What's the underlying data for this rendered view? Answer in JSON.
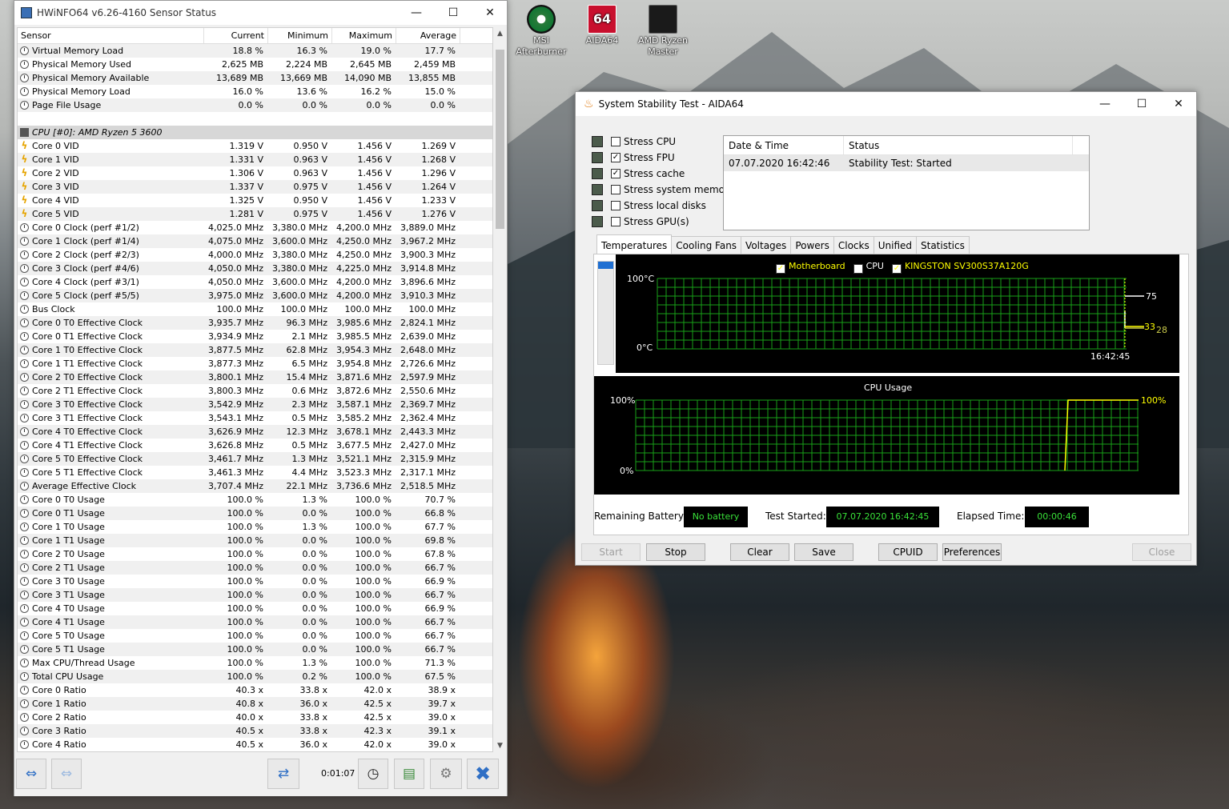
{
  "desktop": {
    "icons": [
      {
        "label": "MSI Afterburner"
      },
      {
        "label": "AIDA64"
      },
      {
        "label": "AMD Ryzen Master"
      }
    ]
  },
  "hwinfo": {
    "title": "HWiNFO64 v6.26-4160 Sensor Status",
    "columns": [
      "Sensor",
      "Current",
      "Minimum",
      "Maximum",
      "Average"
    ],
    "rows": [
      {
        "icon": "clock",
        "name": "Virtual Memory Load",
        "cur": "18.8 %",
        "min": "16.3 %",
        "max": "19.0 %",
        "avg": "17.7 %"
      },
      {
        "icon": "clock",
        "name": "Physical Memory Used",
        "cur": "2,625 MB",
        "min": "2,224 MB",
        "max": "2,645 MB",
        "avg": "2,459 MB"
      },
      {
        "icon": "clock",
        "name": "Physical Memory Available",
        "cur": "13,689 MB",
        "min": "13,669 MB",
        "max": "14,090 MB",
        "avg": "13,855 MB"
      },
      {
        "icon": "clock",
        "name": "Physical Memory Load",
        "cur": "16.0 %",
        "min": "13.6 %",
        "max": "16.2 %",
        "avg": "15.0 %"
      },
      {
        "icon": "clock",
        "name": "Page File Usage",
        "cur": "0.0 %",
        "min": "0.0 %",
        "max": "0.0 %",
        "avg": "0.0 %"
      },
      {
        "icon": "none",
        "name": "",
        "cur": "",
        "min": "",
        "max": "",
        "avg": ""
      },
      {
        "icon": "chip",
        "group": true,
        "name": "CPU [#0]: AMD Ryzen 5 3600",
        "cur": "",
        "min": "",
        "max": "",
        "avg": ""
      },
      {
        "icon": "volt",
        "name": "Core 0 VID",
        "cur": "1.319 V",
        "min": "0.950 V",
        "max": "1.456 V",
        "avg": "1.269 V"
      },
      {
        "icon": "volt",
        "name": "Core 1 VID",
        "cur": "1.331 V",
        "min": "0.963 V",
        "max": "1.456 V",
        "avg": "1.268 V"
      },
      {
        "icon": "volt",
        "name": "Core 2 VID",
        "cur": "1.306 V",
        "min": "0.963 V",
        "max": "1.456 V",
        "avg": "1.296 V"
      },
      {
        "icon": "volt",
        "name": "Core 3 VID",
        "cur": "1.337 V",
        "min": "0.975 V",
        "max": "1.456 V",
        "avg": "1.264 V"
      },
      {
        "icon": "volt",
        "name": "Core 4 VID",
        "cur": "1.325 V",
        "min": "0.950 V",
        "max": "1.456 V",
        "avg": "1.233 V"
      },
      {
        "icon": "volt",
        "name": "Core 5 VID",
        "cur": "1.281 V",
        "min": "0.975 V",
        "max": "1.456 V",
        "avg": "1.276 V"
      },
      {
        "icon": "clock",
        "name": "Core 0 Clock (perf #1/2)",
        "cur": "4,025.0 MHz",
        "min": "3,380.0 MHz",
        "max": "4,200.0 MHz",
        "avg": "3,889.0 MHz"
      },
      {
        "icon": "clock",
        "name": "Core 1 Clock (perf #1/4)",
        "cur": "4,075.0 MHz",
        "min": "3,600.0 MHz",
        "max": "4,250.0 MHz",
        "avg": "3,967.2 MHz"
      },
      {
        "icon": "clock",
        "name": "Core 2 Clock (perf #2/3)",
        "cur": "4,000.0 MHz",
        "min": "3,380.0 MHz",
        "max": "4,250.0 MHz",
        "avg": "3,900.3 MHz"
      },
      {
        "icon": "clock",
        "name": "Core 3 Clock (perf #4/6)",
        "cur": "4,050.0 MHz",
        "min": "3,380.0 MHz",
        "max": "4,225.0 MHz",
        "avg": "3,914.8 MHz"
      },
      {
        "icon": "clock",
        "name": "Core 4 Clock (perf #3/1)",
        "cur": "4,050.0 MHz",
        "min": "3,600.0 MHz",
        "max": "4,200.0 MHz",
        "avg": "3,896.6 MHz"
      },
      {
        "icon": "clock",
        "name": "Core 5 Clock (perf #5/5)",
        "cur": "3,975.0 MHz",
        "min": "3,600.0 MHz",
        "max": "4,200.0 MHz",
        "avg": "3,910.3 MHz"
      },
      {
        "icon": "clock",
        "name": "Bus Clock",
        "cur": "100.0 MHz",
        "min": "100.0 MHz",
        "max": "100.0 MHz",
        "avg": "100.0 MHz"
      },
      {
        "icon": "clock",
        "name": "Core 0 T0 Effective Clock",
        "cur": "3,935.7 MHz",
        "min": "96.3 MHz",
        "max": "3,985.6 MHz",
        "avg": "2,824.1 MHz"
      },
      {
        "icon": "clock",
        "name": "Core 0 T1 Effective Clock",
        "cur": "3,934.9 MHz",
        "min": "2.1 MHz",
        "max": "3,985.5 MHz",
        "avg": "2,639.0 MHz"
      },
      {
        "icon": "clock",
        "name": "Core 1 T0 Effective Clock",
        "cur": "3,877.5 MHz",
        "min": "62.8 MHz",
        "max": "3,954.3 MHz",
        "avg": "2,648.0 MHz"
      },
      {
        "icon": "clock",
        "name": "Core 1 T1 Effective Clock",
        "cur": "3,877.3 MHz",
        "min": "6.5 MHz",
        "max": "3,954.8 MHz",
        "avg": "2,726.6 MHz"
      },
      {
        "icon": "clock",
        "name": "Core 2 T0 Effective Clock",
        "cur": "3,800.1 MHz",
        "min": "15.4 MHz",
        "max": "3,871.6 MHz",
        "avg": "2,597.9 MHz"
      },
      {
        "icon": "clock",
        "name": "Core 2 T1 Effective Clock",
        "cur": "3,800.3 MHz",
        "min": "0.6 MHz",
        "max": "3,872.6 MHz",
        "avg": "2,550.6 MHz"
      },
      {
        "icon": "clock",
        "name": "Core 3 T0 Effective Clock",
        "cur": "3,542.9 MHz",
        "min": "2.3 MHz",
        "max": "3,587.1 MHz",
        "avg": "2,369.7 MHz"
      },
      {
        "icon": "clock",
        "name": "Core 3 T1 Effective Clock",
        "cur": "3,543.1 MHz",
        "min": "0.5 MHz",
        "max": "3,585.2 MHz",
        "avg": "2,362.4 MHz"
      },
      {
        "icon": "clock",
        "name": "Core 4 T0 Effective Clock",
        "cur": "3,626.9 MHz",
        "min": "12.3 MHz",
        "max": "3,678.1 MHz",
        "avg": "2,443.3 MHz"
      },
      {
        "icon": "clock",
        "name": "Core 4 T1 Effective Clock",
        "cur": "3,626.8 MHz",
        "min": "0.5 MHz",
        "max": "3,677.5 MHz",
        "avg": "2,427.0 MHz"
      },
      {
        "icon": "clock",
        "name": "Core 5 T0 Effective Clock",
        "cur": "3,461.7 MHz",
        "min": "1.3 MHz",
        "max": "3,521.1 MHz",
        "avg": "2,315.9 MHz"
      },
      {
        "icon": "clock",
        "name": "Core 5 T1 Effective Clock",
        "cur": "3,461.3 MHz",
        "min": "4.4 MHz",
        "max": "3,523.3 MHz",
        "avg": "2,317.1 MHz"
      },
      {
        "icon": "clock",
        "name": "Average Effective Clock",
        "cur": "3,707.4 MHz",
        "min": "22.1 MHz",
        "max": "3,736.6 MHz",
        "avg": "2,518.5 MHz"
      },
      {
        "icon": "clock",
        "name": "Core 0 T0 Usage",
        "cur": "100.0 %",
        "min": "1.3 %",
        "max": "100.0 %",
        "avg": "70.7 %"
      },
      {
        "icon": "clock",
        "name": "Core 0 T1 Usage",
        "cur": "100.0 %",
        "min": "0.0 %",
        "max": "100.0 %",
        "avg": "66.8 %"
      },
      {
        "icon": "clock",
        "name": "Core 1 T0 Usage",
        "cur": "100.0 %",
        "min": "1.3 %",
        "max": "100.0 %",
        "avg": "67.7 %"
      },
      {
        "icon": "clock",
        "name": "Core 1 T1 Usage",
        "cur": "100.0 %",
        "min": "0.0 %",
        "max": "100.0 %",
        "avg": "69.8 %"
      },
      {
        "icon": "clock",
        "name": "Core 2 T0 Usage",
        "cur": "100.0 %",
        "min": "0.0 %",
        "max": "100.0 %",
        "avg": "67.8 %"
      },
      {
        "icon": "clock",
        "name": "Core 2 T1 Usage",
        "cur": "100.0 %",
        "min": "0.0 %",
        "max": "100.0 %",
        "avg": "66.7 %"
      },
      {
        "icon": "clock",
        "name": "Core 3 T0 Usage",
        "cur": "100.0 %",
        "min": "0.0 %",
        "max": "100.0 %",
        "avg": "66.9 %"
      },
      {
        "icon": "clock",
        "name": "Core 3 T1 Usage",
        "cur": "100.0 %",
        "min": "0.0 %",
        "max": "100.0 %",
        "avg": "66.7 %"
      },
      {
        "icon": "clock",
        "name": "Core 4 T0 Usage",
        "cur": "100.0 %",
        "min": "0.0 %",
        "max": "100.0 %",
        "avg": "66.9 %"
      },
      {
        "icon": "clock",
        "name": "Core 4 T1 Usage",
        "cur": "100.0 %",
        "min": "0.0 %",
        "max": "100.0 %",
        "avg": "66.7 %"
      },
      {
        "icon": "clock",
        "name": "Core 5 T0 Usage",
        "cur": "100.0 %",
        "min": "0.0 %",
        "max": "100.0 %",
        "avg": "66.7 %"
      },
      {
        "icon": "clock",
        "name": "Core 5 T1 Usage",
        "cur": "100.0 %",
        "min": "0.0 %",
        "max": "100.0 %",
        "avg": "66.7 %"
      },
      {
        "icon": "clock",
        "name": "Max CPU/Thread Usage",
        "cur": "100.0 %",
        "min": "1.3 %",
        "max": "100.0 %",
        "avg": "71.3 %"
      },
      {
        "icon": "clock",
        "name": "Total CPU Usage",
        "cur": "100.0 %",
        "min": "0.2 %",
        "max": "100.0 %",
        "avg": "67.5 %"
      },
      {
        "icon": "clock",
        "name": "Core 0 Ratio",
        "cur": "40.3 x",
        "min": "33.8 x",
        "max": "42.0 x",
        "avg": "38.9 x"
      },
      {
        "icon": "clock",
        "name": "Core 1 Ratio",
        "cur": "40.8 x",
        "min": "36.0 x",
        "max": "42.5 x",
        "avg": "39.7 x"
      },
      {
        "icon": "clock",
        "name": "Core 2 Ratio",
        "cur": "40.0 x",
        "min": "33.8 x",
        "max": "42.5 x",
        "avg": "39.0 x"
      },
      {
        "icon": "clock",
        "name": "Core 3 Ratio",
        "cur": "40.5 x",
        "min": "33.8 x",
        "max": "42.3 x",
        "avg": "39.1 x"
      },
      {
        "icon": "clock",
        "name": "Core 4 Ratio",
        "cur": "40.5 x",
        "min": "36.0 x",
        "max": "42.0 x",
        "avg": "39.0 x"
      }
    ],
    "footer": {
      "timer": "0:01:07"
    }
  },
  "aida": {
    "title": "System Stability Test - AIDA64",
    "stress": [
      {
        "label": "Stress CPU",
        "checked": false
      },
      {
        "label": "Stress FPU",
        "checked": true
      },
      {
        "label": "Stress cache",
        "checked": true
      },
      {
        "label": "Stress system memory",
        "checked": false
      },
      {
        "label": "Stress local disks",
        "checked": false
      },
      {
        "label": "Stress GPU(s)",
        "checked": false
      }
    ],
    "log": {
      "col_date": "Date & Time",
      "col_status": "Status",
      "date": "07.07.2020 16:42:46",
      "status": "Stability Test: Started"
    },
    "tabs": [
      "Temperatures",
      "Cooling Fans",
      "Voltages",
      "Powers",
      "Clocks",
      "Unified",
      "Statistics"
    ],
    "temp_graph": {
      "legend": [
        "Motherboard",
        "CPU",
        "KINGSTON SV300S37A120G"
      ],
      "y_top": "100°C",
      "y_bottom": "0°C",
      "time": "16:42:45",
      "val_cpu": "75",
      "val_mb": "33",
      "val_disk": "28",
      "colors": {
        "motherboard": "#ffff00",
        "cpu": "#ffffff",
        "disk": "#c8c84a",
        "grid": "#18a018"
      }
    },
    "cpu_graph": {
      "title": "CPU Usage",
      "y_top": "100%",
      "y_bottom": "0%",
      "value": "100%"
    },
    "status": {
      "battery_label": "Remaining Battery:",
      "battery_value": "No battery",
      "started_label": "Test Started:",
      "started_value": "07.07.2020 16:42:45",
      "elapsed_label": "Elapsed Time:",
      "elapsed_value": "00:00:46"
    },
    "buttons": {
      "start": "Start",
      "stop": "Stop",
      "clear": "Clear",
      "save": "Save",
      "cpuid": "CPUID",
      "preferences": "Preferences",
      "close": "Close"
    }
  }
}
